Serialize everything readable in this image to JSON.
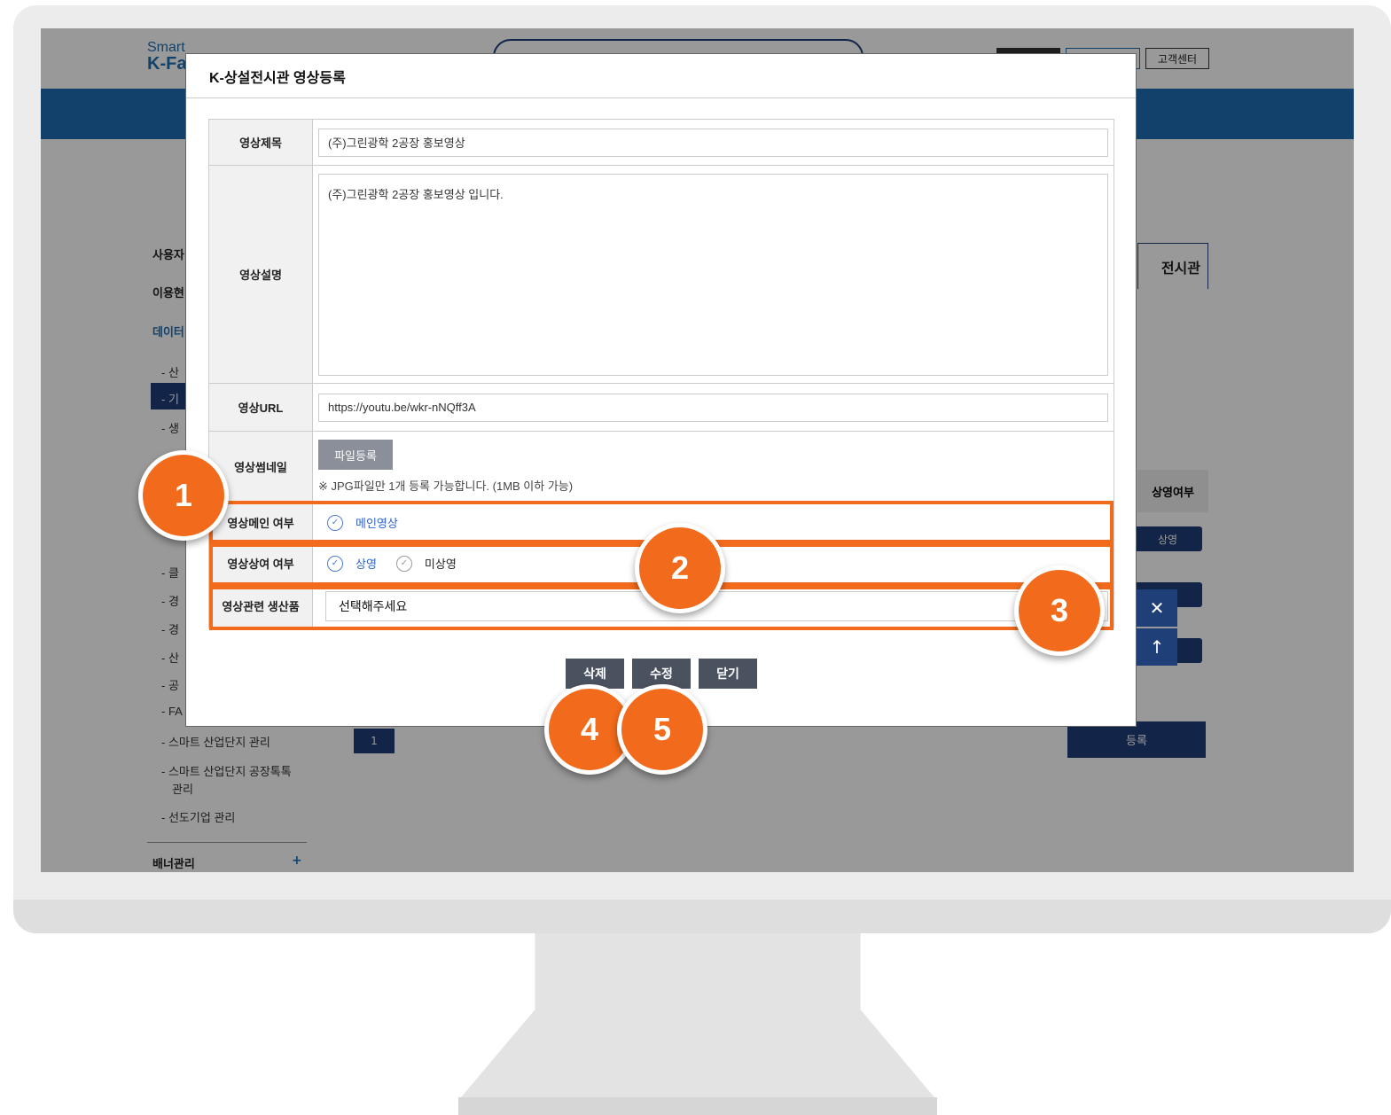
{
  "header": {
    "logo_line1": "Smart",
    "logo_line2": "K-Fa",
    "customer_center": "고객센터"
  },
  "sidebar": {
    "items": [
      "사용자",
      "이용현",
      "데이터"
    ],
    "sub_items": [
      "- 산",
      "- 기",
      "- 생",
      "- 클",
      "- 경",
      "- 경",
      "- 산",
      "- 공",
      "- FA",
      "- 스마트 산업단지 관리",
      "- 스마트 산업단지 공장톡톡",
      "관리",
      "- 선도기업 관리"
    ],
    "banner_menu": "배너관리",
    "banner_plus": "+"
  },
  "background": {
    "tab_label": "전시관",
    "column_header": "상영여부",
    "status_button": "상영",
    "page_number": "1",
    "register_button": "등록",
    "close_icon": "close-icon",
    "up_icon": "arrow-up-icon"
  },
  "modal": {
    "title": "K-상설전시관 영상등록",
    "fields": {
      "title_label": "영상제목",
      "title_value": "(주)그린광학 2공장 홍보영상",
      "desc_label": "영상설명",
      "desc_value": "(주)그린광학 2공장 홍보영상 입니다.",
      "url_label": "영상URL",
      "url_value": "https://youtu.be/wkr-nNQff3A",
      "thumb_label": "영상썸네일",
      "file_button": "파일등록",
      "file_note": "※ JPG파일만 1개 등록 가능합니다. (1MB 이하 가능)",
      "main_label": "영상메인 여부",
      "main_option": "메인영상",
      "screening_label": "영상상여 여부",
      "screening_on": "상영",
      "screening_off": "미상영",
      "product_label": "영상관련 생산품",
      "product_placeholder": "선택해주세요"
    },
    "buttons": {
      "delete": "삭제",
      "edit": "수정",
      "close": "닫기"
    }
  },
  "callouts": [
    "1",
    "2",
    "3",
    "4",
    "5"
  ],
  "colors": {
    "accent": "#f26a1b",
    "brand": "#1f6fb2",
    "dark_navy": "#1f3f78",
    "modal_button": "#4a5260",
    "radio_active": "#2f64c8"
  }
}
